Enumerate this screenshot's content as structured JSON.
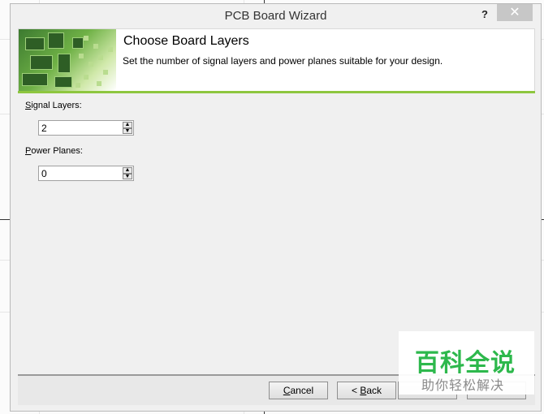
{
  "window": {
    "title": "PCB Board Wizard",
    "help_label": "?",
    "close_label": "✕"
  },
  "header": {
    "title": "Choose Board Layers",
    "subtitle": "Set the number of signal layers and power planes suitable for your design."
  },
  "fields": {
    "signal_layers": {
      "mnemonic": "S",
      "label_rest": "ignal Layers:",
      "value": "2"
    },
    "power_planes": {
      "mnemonic": "P",
      "label_rest": "ower Planes:",
      "value": "0"
    }
  },
  "buttons": {
    "cancel": {
      "mnemonic": "C",
      "rest": "ancel"
    },
    "back": {
      "prefix": "< ",
      "mnemonic": "B",
      "rest": "ack"
    }
  },
  "spin": {
    "up": "▲",
    "down": "▼"
  },
  "watermark": {
    "big": "百科全说",
    "small": "助你轻松解决"
  },
  "colors": {
    "accent_green": "#8ec63f",
    "watermark_green": "#2db84c",
    "close_button": "#c7c7c7"
  }
}
